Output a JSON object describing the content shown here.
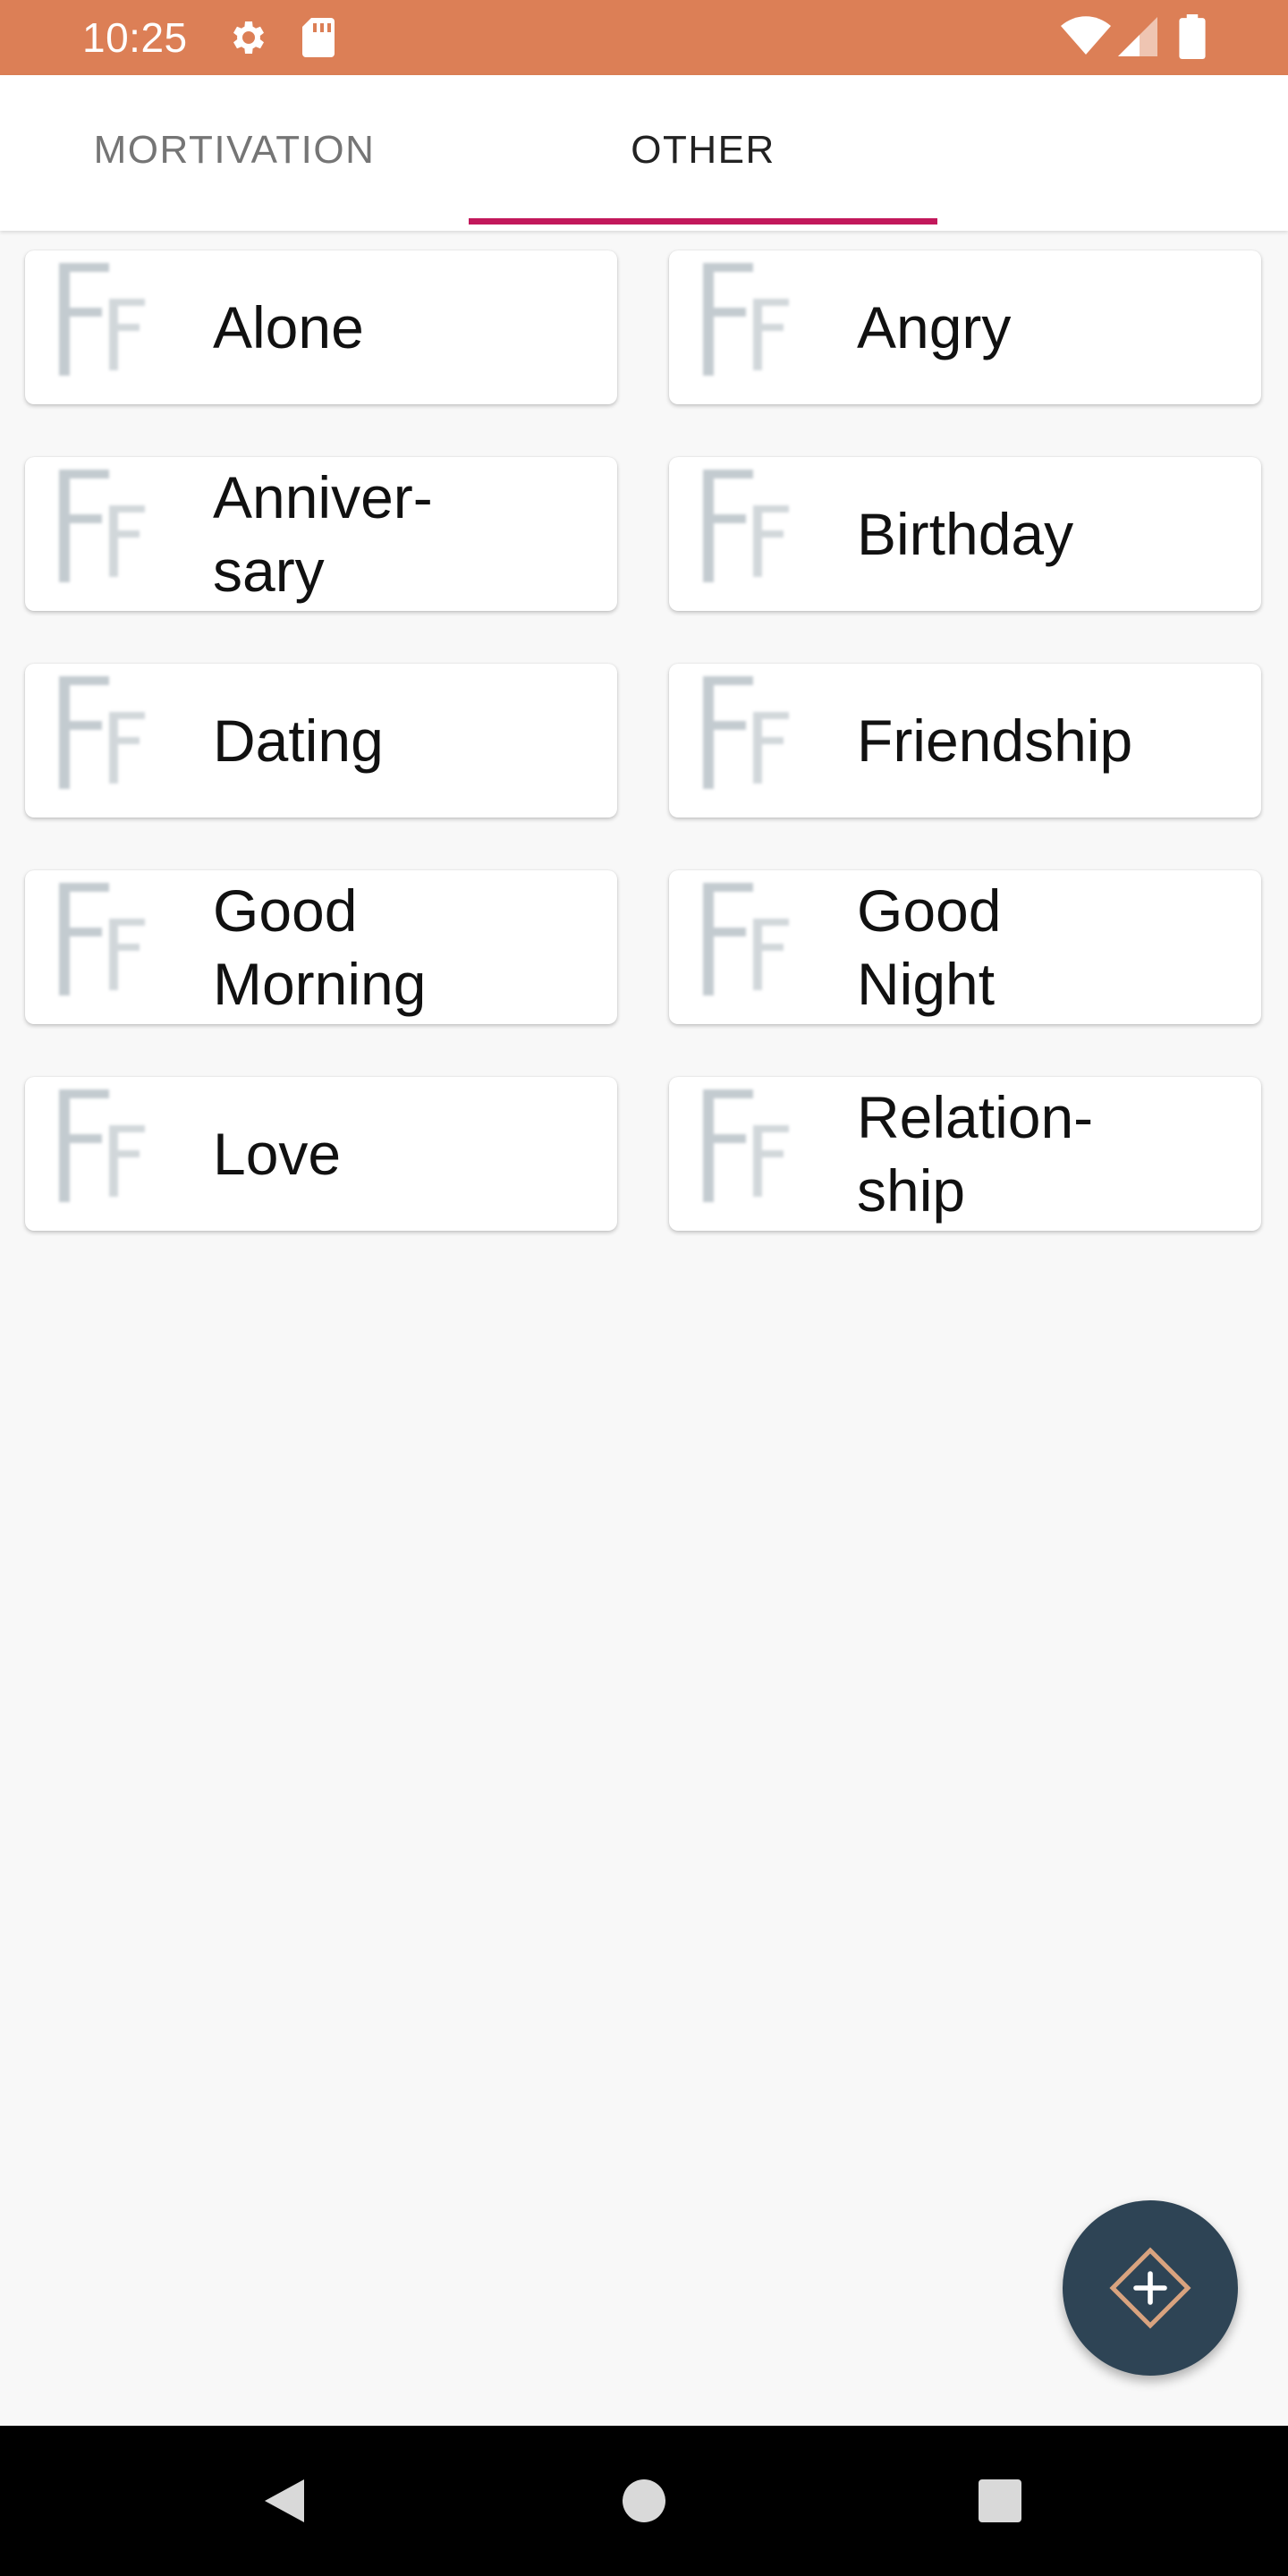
{
  "status_bar": {
    "time": "10:25",
    "icons": [
      "gear-icon",
      "sd-card-icon",
      "wifi-icon",
      "signal-icon",
      "battery-icon"
    ],
    "background": "#dc7f56"
  },
  "tabs": [
    {
      "label": "MORTIVATION",
      "active": false
    },
    {
      "label": "OTHER",
      "active": true
    }
  ],
  "accent_color": "#c2185b",
  "categories": [
    {
      "label": "Alone"
    },
    {
      "label": "Angry"
    },
    {
      "label": "Anniver-\nsary"
    },
    {
      "label": "Birthday"
    },
    {
      "label": "Dating"
    },
    {
      "label": "Friendship"
    },
    {
      "label": "Good\nMorning"
    },
    {
      "label": "Good\nNight"
    },
    {
      "label": "Love"
    },
    {
      "label": "Relation-\nship"
    }
  ],
  "fab": {
    "icon": "add-diamond-icon",
    "color": "#2e4455"
  },
  "nav_bar": {
    "icons": [
      "back-icon",
      "home-icon",
      "recent-apps-icon"
    ]
  }
}
